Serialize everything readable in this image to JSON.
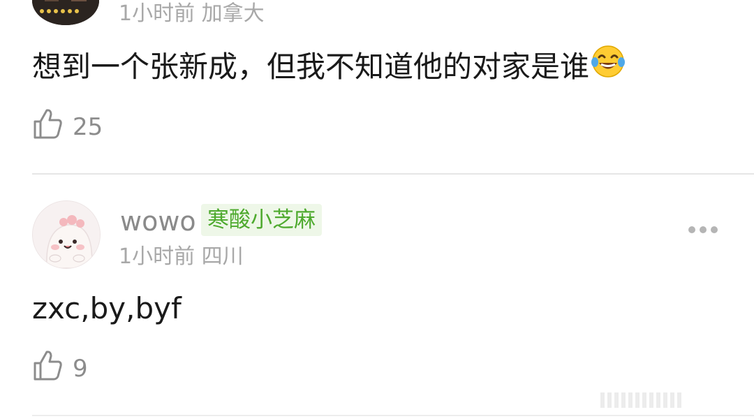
{
  "comments": [
    {
      "time": "1小时前",
      "location": "加拿大",
      "text": "想到一个张新成，但我不知道他的对家是谁",
      "emoji": "laughing-with-tears",
      "likes": "25"
    },
    {
      "username": "wowo",
      "badge": "寒酸小芝麻",
      "time": "1小时前",
      "location": "四川",
      "text": "zxc,by,byf",
      "likes": "9"
    }
  ],
  "colors": {
    "meta": "#a8a8a8",
    "text": "#1a1a1a",
    "badge_bg": "#eef7e8",
    "badge_text": "#4eaa2e",
    "divider": "#e6e6e6"
  }
}
